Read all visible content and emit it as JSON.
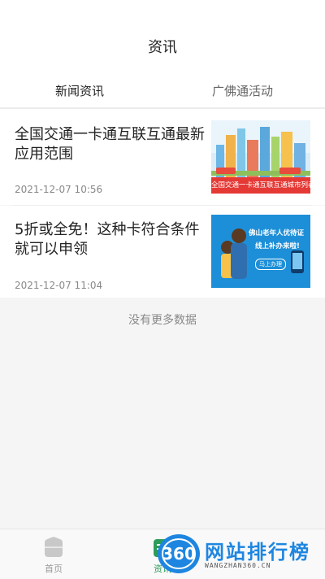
{
  "header": {
    "title": "资讯",
    "tabs": [
      {
        "label": "新闻资讯",
        "active": true
      },
      {
        "label": "广佛通活动",
        "active": false
      }
    ]
  },
  "articles": [
    {
      "title": "全国交通一卡通互联互通最新应用范围",
      "date": "2021-12-07 10:56",
      "thumb_caption": "全国交通一卡通互联互通城市列表"
    },
    {
      "title": "5折或全免！这种卡符合条件就可以申领",
      "date": "2021-12-07 11:04",
      "thumb_caption_line1": "佛山老年人优待证",
      "thumb_caption_line2": "线上补办来啦!",
      "thumb_badge": "马上办理"
    }
  ],
  "list_end_text": "没有更多数据",
  "bottom_nav": [
    {
      "label": "首页",
      "icon": "home-icon",
      "active": false
    },
    {
      "label": "资讯",
      "icon": "news-icon",
      "active": true
    }
  ],
  "watermark": {
    "logo_text": "360",
    "title": "网站排行榜",
    "subtitle": "WANGZHAN360.CN"
  },
  "colors": {
    "accent": "#2c9c5a",
    "watermark_blue": "#1e86e0"
  }
}
